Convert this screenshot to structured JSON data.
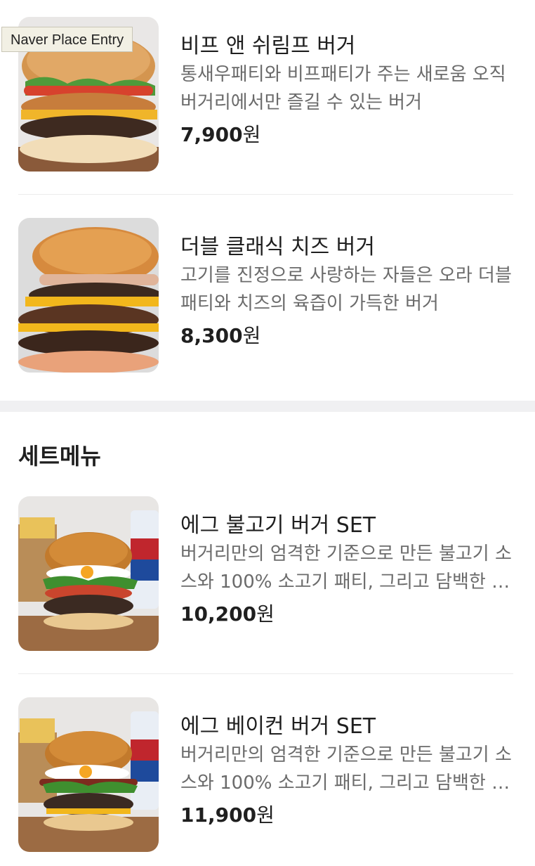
{
  "tooltip": "Naver Place Entry",
  "menu": {
    "items": [
      {
        "name": "비프 앤 쉬림프 버거",
        "description": "통새우패티와 비프패티가 주는 새로움 오직 버거리에서만 즐길 수 있는 버거",
        "price": "7,900",
        "currency": "원",
        "image_icon": "beef-shrimp-burger-photo"
      },
      {
        "name": "더블 클래식 치즈 버거",
        "description": "고기를 진정으로 사랑하는 자들은 오라 더블패티와 치즈의 육즙이 가득한 버거",
        "price": "8,300",
        "currency": "원",
        "image_icon": "double-cheese-burger-photo"
      }
    ]
  },
  "set_menu": {
    "title": "세트메뉴",
    "items": [
      {
        "name": "에그 불고기 버거 SET",
        "description": "버거리만의 엄격한 기준으로 만든 불고기 소스와 100% 소고기 패티, 그리고 담백한 계란",
        "price": "10,200",
        "currency": "원",
        "image_icon": "egg-bulgogi-burger-set-photo"
      },
      {
        "name": "에그 베이컨 버거 SET",
        "description": "버거리만의 엄격한 기준으로 만든 불고기 소스와 100% 소고기 패티, 그리고 담백한 베이컨",
        "price": "11,900",
        "currency": "원",
        "image_icon": "egg-bacon-burger-set-photo"
      }
    ]
  },
  "colors": {
    "text_primary": "#1f1f1f",
    "text_secondary": "#6b6b6b",
    "divider": "#ececec",
    "section_gap": "#f0f0f2",
    "tooltip_bg": "#f2f0e4"
  }
}
